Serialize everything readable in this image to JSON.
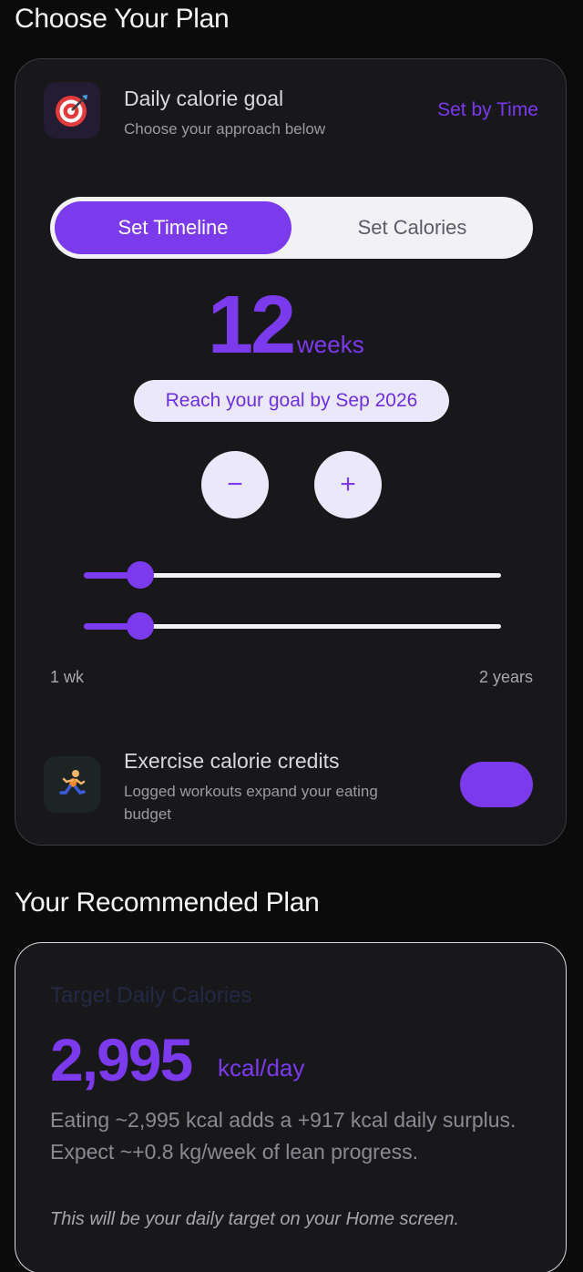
{
  "colors": {
    "accent": "#7c3aed",
    "background": "#0b0b0c",
    "card": "#18181b",
    "pill": "#ece8fb"
  },
  "plan": {
    "section_title": "Choose Your Plan",
    "goal_title": "Daily calorie goal",
    "goal_subtitle": "Choose your approach below",
    "set_by_label": "Set by Time",
    "goal_icon": "bullseye-dart-icon",
    "segmented": {
      "options": [
        "Set Timeline",
        "Set Calories"
      ],
      "selected": "Set Timeline"
    },
    "weeks_value": "12",
    "weeks_unit": "weeks",
    "reach_text": "Reach your goal by Sep 2026",
    "decrement_label": "−",
    "increment_label": "+",
    "slider_position_fraction": 0.11,
    "range_min_label": "1 wk",
    "range_max_label": "2 years",
    "exercise": {
      "icon": "running-person-icon",
      "title": "Exercise calorie credits",
      "subtitle": "Logged workouts expand your eating budget",
      "toggle_on": true
    }
  },
  "recommended": {
    "section_title": "Your Recommended Plan",
    "label": "Target Daily Calories",
    "kcal_value": "2,995",
    "kcal_unit": "kcal/day",
    "description": "Eating ~2,995 kcal adds a +917 kcal daily surplus. Expect ~+0.8 kg/week of lean progress.",
    "note": "This will be your daily target on your Home screen."
  }
}
